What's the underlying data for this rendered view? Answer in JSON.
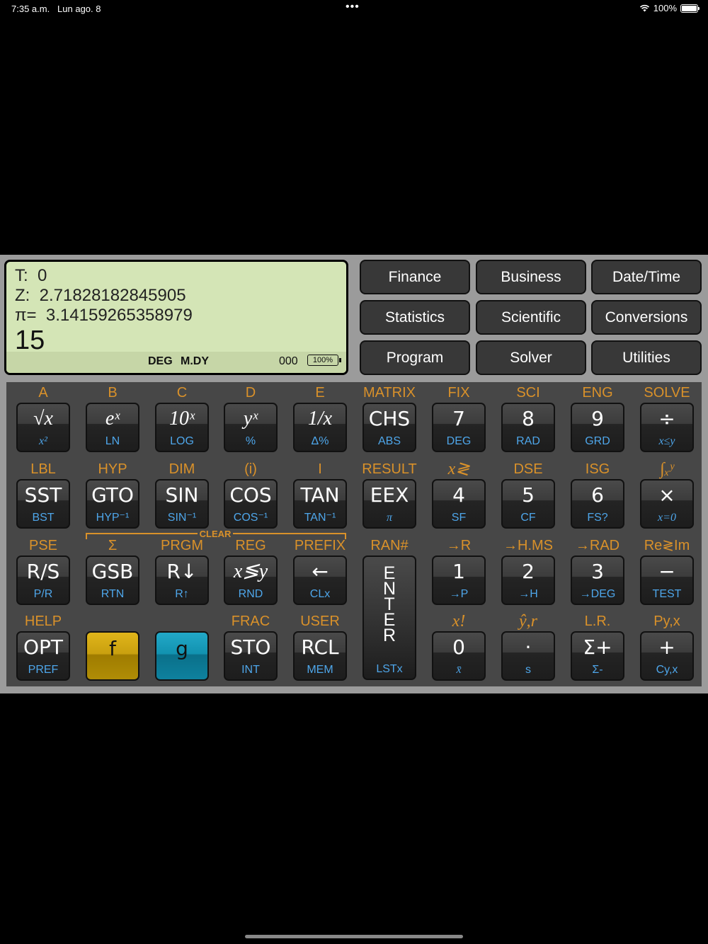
{
  "status_bar": {
    "time": "7:35 a.m.",
    "date": "Lun ago. 8",
    "dots": "•••",
    "battery_pct": "100%"
  },
  "display": {
    "t_line": "T:  0",
    "z_line": "Z:  2.71828182845905",
    "pi_line": "π=  3.14159265358979",
    "entry": "15_",
    "angle_mode": "DEG",
    "date_mode": "M.DY",
    "counter": "000",
    "battery": "100%"
  },
  "menu": [
    {
      "label": "Finance"
    },
    {
      "label": "Business"
    },
    {
      "label": "Date/Time"
    },
    {
      "label": "Statistics"
    },
    {
      "label": "Scientific"
    },
    {
      "label": "Conversions"
    },
    {
      "label": "Program"
    },
    {
      "label": "Solver"
    },
    {
      "label": "Utilities"
    }
  ],
  "clear_label": "CLEAR",
  "keys": [
    {
      "name": "sqrt-key",
      "f": "A",
      "main": "√x",
      "g": "x²",
      "serif": true,
      "gserif": true
    },
    {
      "name": "exp-key",
      "f": "B",
      "main": "eˣ",
      "g": "LN",
      "serif": true
    },
    {
      "name": "ten-pow-key",
      "f": "C",
      "main": "10ˣ",
      "g": "LOG",
      "serif": true
    },
    {
      "name": "y-pow-x-key",
      "f": "D",
      "main": "yˣ",
      "g": "%",
      "serif": true
    },
    {
      "name": "reciprocal-key",
      "f": "E",
      "main": "1/x",
      "g": "Δ%",
      "serif": true
    },
    {
      "name": "chs-key",
      "f": "MATRIX",
      "main": "CHS",
      "g": "ABS"
    },
    {
      "name": "digit-7-key",
      "f": "FIX",
      "main": "7",
      "g": "DEG"
    },
    {
      "name": "digit-8-key",
      "f": "SCI",
      "main": "8",
      "g": "RAD"
    },
    {
      "name": "digit-9-key",
      "f": "ENG",
      "main": "9",
      "g": "GRD"
    },
    {
      "name": "divide-key",
      "f": "SOLVE",
      "main": "÷",
      "g": "x≤y",
      "gserif": true
    },
    {
      "name": "sst-key",
      "f": "LBL",
      "main": "SST",
      "g": "BST"
    },
    {
      "name": "gto-key",
      "f": "HYP",
      "main": "GTO",
      "g": "HYP⁻¹"
    },
    {
      "name": "sin-key",
      "f": "DIM",
      "main": "SIN",
      "g": "SIN⁻¹"
    },
    {
      "name": "cos-key",
      "f": "(i)",
      "main": "COS",
      "g": "COS⁻¹"
    },
    {
      "name": "tan-key",
      "f": "I",
      "main": "TAN",
      "g": "TAN⁻¹"
    },
    {
      "name": "eex-key",
      "f": "RESULT",
      "main": "EEX",
      "g": "π",
      "gserif": true
    },
    {
      "name": "digit-4-key",
      "f": "x≷",
      "main": "4",
      "g": "SF"
    },
    {
      "name": "digit-5-key",
      "f": "DSE",
      "main": "5",
      "g": "CF"
    },
    {
      "name": "digit-6-key",
      "f": "ISG",
      "main": "6",
      "g": "FS?"
    },
    {
      "name": "multiply-key",
      "f": "∫ₓʸ",
      "main": "×",
      "g": "x=0",
      "gserif": true
    },
    {
      "name": "run-stop-key",
      "f": "PSE",
      "main": "R/S",
      "g": "P/R"
    },
    {
      "name": "gsb-key",
      "f": "Σ",
      "main": "GSB",
      "g": "RTN"
    },
    {
      "name": "roll-down-key",
      "f": "PRGM",
      "main": "R↓",
      "g": "R↑"
    },
    {
      "name": "x-swap-y-key",
      "f": "REG",
      "main": "x≶y",
      "g": "RND",
      "serif": true
    },
    {
      "name": "backspace-key",
      "f": "PREFIX",
      "main": "←",
      "g": "CLx"
    },
    {
      "name": "enter-key",
      "f": "RAN#",
      "main": "E\nN\nT\nE\nR",
      "g": "LSTx",
      "enter": true
    },
    {
      "name": "digit-1-key",
      "f": "→R",
      "main": "1",
      "g": "→P"
    },
    {
      "name": "digit-2-key",
      "f": "→H.MS",
      "main": "2",
      "g": "→H"
    },
    {
      "name": "digit-3-key",
      "f": "→RAD",
      "main": "3",
      "g": "→DEG"
    },
    {
      "name": "subtract-key",
      "f": "Re≷Im",
      "main": "−",
      "g": "TEST"
    },
    {
      "name": "opt-key",
      "f": "HELP",
      "main": "OPT",
      "g": "PREF"
    },
    {
      "name": "f-shift-key",
      "f": "",
      "main": "f",
      "g": "",
      "fkey": true
    },
    {
      "name": "g-shift-key",
      "f": "",
      "main": "g",
      "g": "",
      "gkey": true
    },
    {
      "name": "sto-key",
      "f": "FRAC",
      "main": "STO",
      "g": "INT"
    },
    {
      "name": "rcl-key",
      "f": "USER",
      "main": "RCL",
      "g": "MEM"
    },
    {
      "name": "digit-0-key",
      "f": "x!",
      "main": "0",
      "g": "x̄",
      "gserif": true
    },
    {
      "name": "decimal-key",
      "f": "ŷ,r",
      "main": "·",
      "g": "s"
    },
    {
      "name": "sigma-plus-key",
      "f": "L.R.",
      "main": "Σ+",
      "g": "Σ-"
    },
    {
      "name": "add-key",
      "f": "Py,x",
      "main": "+",
      "g": "Cy,x"
    }
  ]
}
